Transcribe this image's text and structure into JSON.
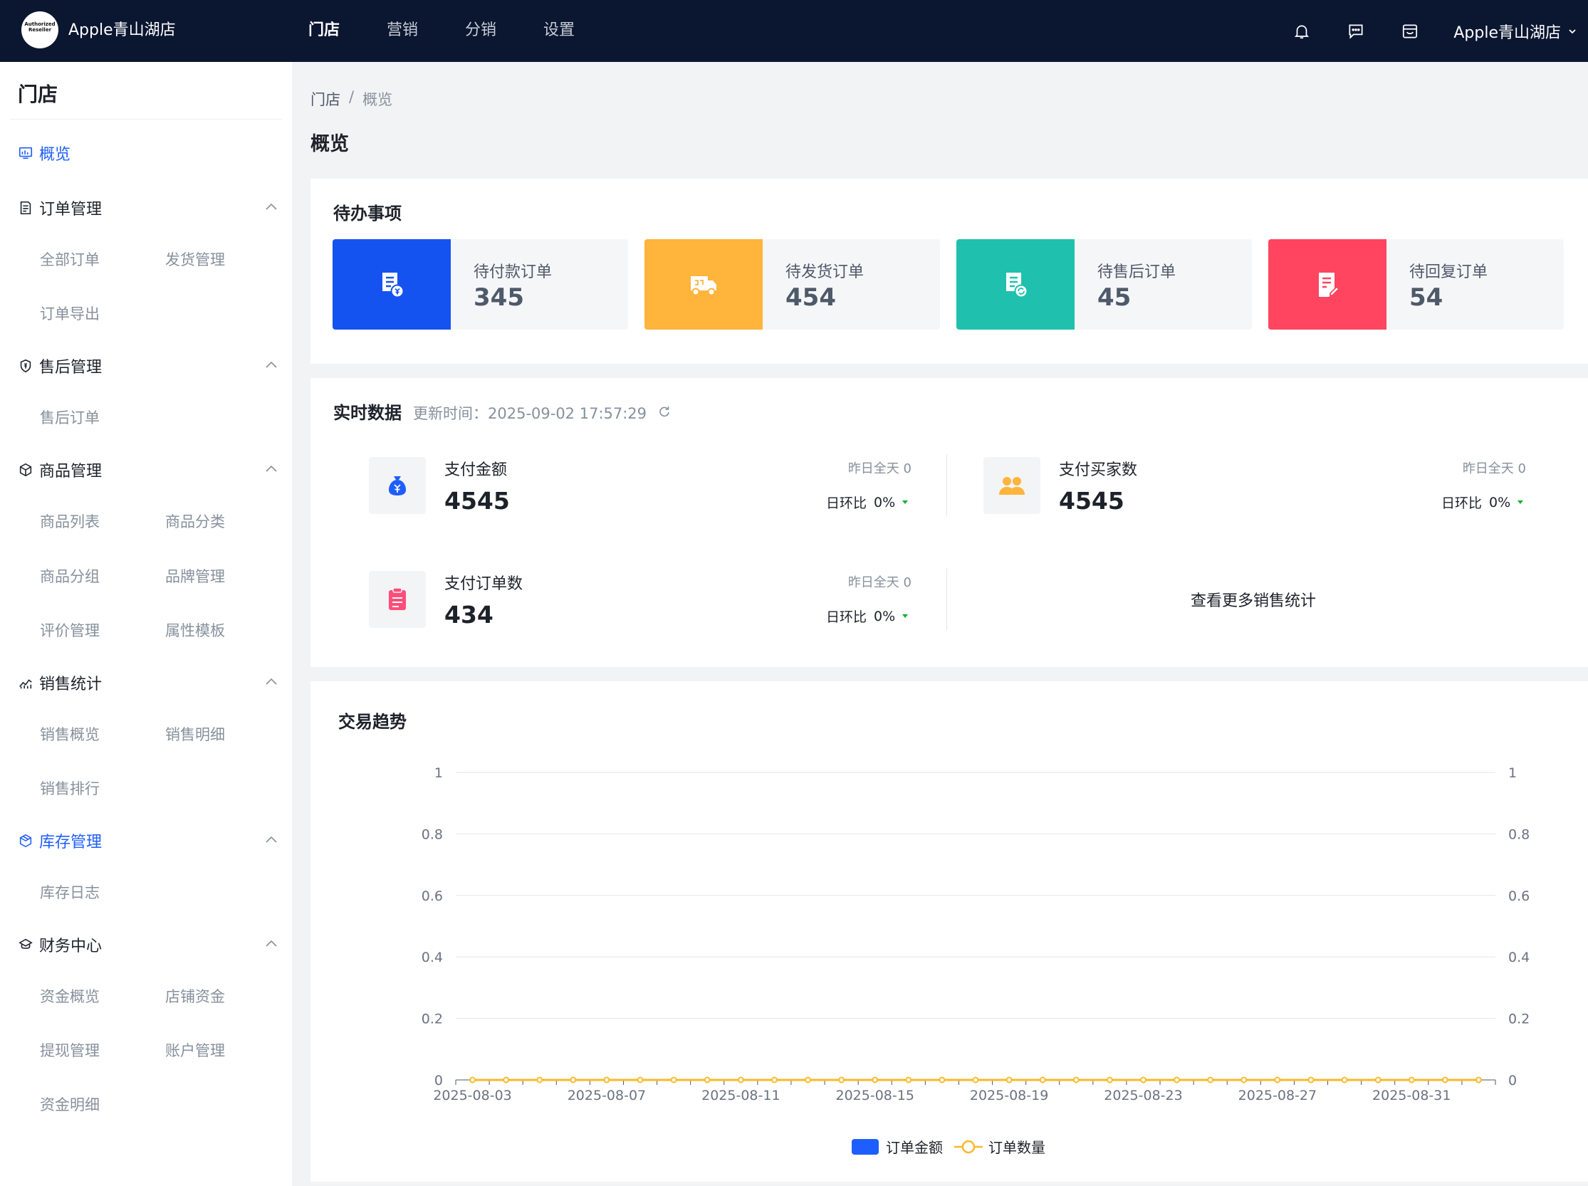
{
  "header": {
    "logo_line1": "Authorized",
    "logo_line2": "Reseller",
    "store_name": "Apple青山湖店",
    "nav": [
      "门店",
      "营销",
      "分销",
      "设置"
    ],
    "active_nav": 0,
    "account_name": "Apple青山湖店"
  },
  "sidebar": {
    "title": "门店",
    "overview": "概览",
    "groups": [
      {
        "label": "订单管理",
        "icon": "order-doc-icon",
        "items": [
          "全部订单",
          "发货管理",
          "订单导出"
        ]
      },
      {
        "label": "售后管理",
        "icon": "shield-icon",
        "items": [
          "售后订单"
        ]
      },
      {
        "label": "商品管理",
        "icon": "box-icon",
        "items": [
          "商品列表",
          "商品分类",
          "商品分组",
          "品牌管理",
          "评价管理",
          "属性模板"
        ]
      },
      {
        "label": "销售统计",
        "icon": "trend-chart-icon",
        "items": [
          "销售概览",
          "销售明细",
          "销售排行"
        ]
      },
      {
        "label": "库存管理",
        "icon": "inventory-icon",
        "items": [
          "库存日志"
        ]
      },
      {
        "label": "财务中心",
        "icon": "finance-icon",
        "items": [
          "资金概览",
          "店铺资金",
          "提现管理",
          "账户管理",
          "资金明细"
        ]
      }
    ]
  },
  "breadcrumb": {
    "root": "门店",
    "sep": "/",
    "current": "概览"
  },
  "page_title": "概览",
  "todo": {
    "title": "待办事项",
    "cards": [
      {
        "label": "待付款订单",
        "value": "345",
        "color": "#1553f0",
        "icon": "payment-order-icon"
      },
      {
        "label": "待发货订单",
        "value": "454",
        "color": "#ffb43b",
        "icon": "truck-icon"
      },
      {
        "label": "待售后订单",
        "value": "45",
        "color": "#1fc1ae",
        "icon": "aftersale-order-icon"
      },
      {
        "label": "待回复订单",
        "value": "54",
        "color": "#ff4560",
        "icon": "reply-edit-icon"
      }
    ]
  },
  "realtime": {
    "title": "实时数据",
    "update_label": "更新时间：",
    "update_time": "2025-09-02 17:57:29",
    "metrics": [
      {
        "label": "支付金额",
        "value": "4545",
        "yesterday": "昨日全天  0",
        "ratio_label": "日环比",
        "ratio": "0%",
        "icon": "money-bag-icon",
        "color": "#1e5eff"
      },
      {
        "label": "支付买家数",
        "value": "4545",
        "yesterday": "昨日全天  0",
        "ratio_label": "日环比",
        "ratio": "0%",
        "icon": "users-icon",
        "color": "#ffb43b"
      },
      {
        "label": "支付订单数",
        "value": "434",
        "yesterday": "昨日全天  0",
        "ratio_label": "日环比",
        "ratio": "0%",
        "icon": "clipboard-icon",
        "color": "#ff4d7a"
      }
    ],
    "more_link": "查看更多销售统计"
  },
  "trend": {
    "title": "交易趋势"
  },
  "chart_data": {
    "type": "line",
    "title": "交易趋势",
    "x": [
      "2025-08-03",
      "2025-08-04",
      "2025-08-05",
      "2025-08-06",
      "2025-08-07",
      "2025-08-08",
      "2025-08-09",
      "2025-08-10",
      "2025-08-11",
      "2025-08-12",
      "2025-08-13",
      "2025-08-14",
      "2025-08-15",
      "2025-08-16",
      "2025-08-17",
      "2025-08-18",
      "2025-08-19",
      "2025-08-20",
      "2025-08-21",
      "2025-08-22",
      "2025-08-23",
      "2025-08-24",
      "2025-08-25",
      "2025-08-26",
      "2025-08-27",
      "2025-08-28",
      "2025-08-29",
      "2025-08-30",
      "2025-08-31",
      "2025-09-01",
      "2025-09-02"
    ],
    "x_tick_labels": [
      "2025-08-03",
      "2025-08-07",
      "2025-08-11",
      "2025-08-15",
      "2025-08-19",
      "2025-08-23",
      "2025-08-27",
      "2025-08-31"
    ],
    "y_ticks": [
      "0",
      "0.2",
      "0.4",
      "0.6",
      "0.8",
      "1"
    ],
    "ylim": [
      0,
      1
    ],
    "y2lim": [
      0,
      1
    ],
    "grid": true,
    "legend_position": "bottom",
    "series": [
      {
        "name": "订单金额",
        "type": "bar",
        "color": "#1e5eff",
        "values": [
          0,
          0,
          0,
          0,
          0,
          0,
          0,
          0,
          0,
          0,
          0,
          0,
          0,
          0,
          0,
          0,
          0,
          0,
          0,
          0,
          0,
          0,
          0,
          0,
          0,
          0,
          0,
          0,
          0,
          0,
          0
        ]
      },
      {
        "name": "订单数量",
        "type": "line",
        "color": "#f7ba2a",
        "values": [
          0,
          0,
          0,
          0,
          0,
          0,
          0,
          0,
          0,
          0,
          0,
          0,
          0,
          0,
          0,
          0,
          0,
          0,
          0,
          0,
          0,
          0,
          0,
          0,
          0,
          0,
          0,
          0,
          0,
          0,
          0
        ]
      }
    ]
  }
}
